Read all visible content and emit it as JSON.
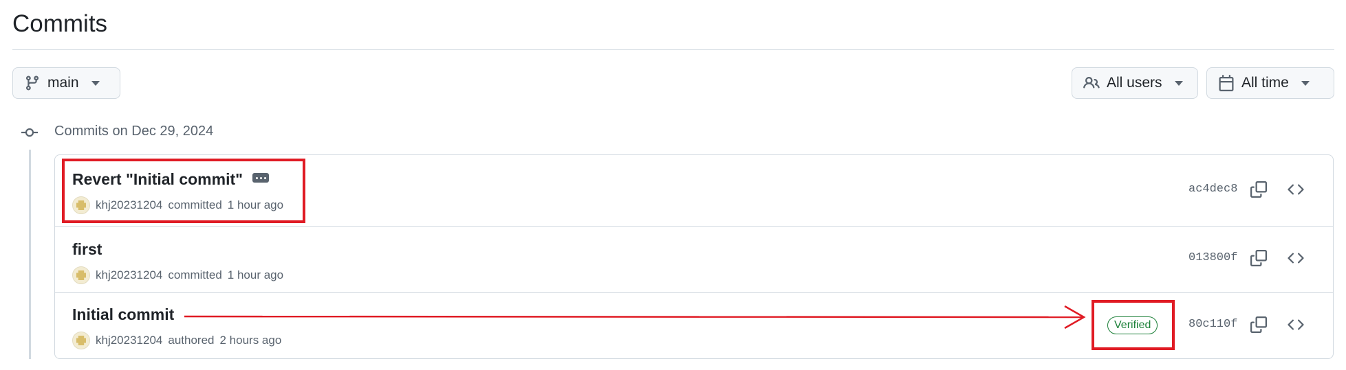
{
  "header": {
    "title": "Commits"
  },
  "filters": {
    "branch_label": "main",
    "users_label": "All users",
    "time_label": "All time"
  },
  "group": {
    "heading": "Commits on Dec 29, 2024"
  },
  "commits": [
    {
      "title": "Revert \"Initial commit\"",
      "author": "khj20231204",
      "action": "committed",
      "time": "1 hour ago",
      "sha": "ac4dec8",
      "verified": false
    },
    {
      "title": "first",
      "author": "khj20231204",
      "action": "committed",
      "time": "1 hour ago",
      "sha": "013800f",
      "verified": false
    },
    {
      "title": "Initial commit",
      "author": "khj20231204",
      "action": "authored",
      "time": "2 hours ago",
      "sha": "80c110f",
      "verified": true,
      "badge_label": "Verified"
    }
  ],
  "annotation_color": "#e01b24",
  "icons": [
    "git-branch-icon",
    "people-icon",
    "calendar-icon",
    "caret-down-icon",
    "git-commit-icon",
    "ellipsis-icon",
    "copy-icon",
    "code-icon"
  ]
}
